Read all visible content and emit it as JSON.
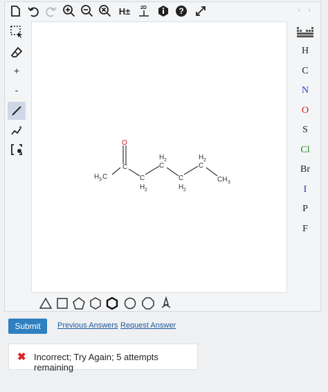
{
  "toolbar": {
    "icons": [
      "new-document",
      "undo",
      "redo",
      "zoom-in",
      "zoom-out",
      "zoom-reset",
      "toggle-hydrogens",
      "clean-2d",
      "info",
      "help",
      "fullscreen"
    ],
    "h_toggle_label": "H±",
    "clean_label": "2D",
    "help_label": "?"
  },
  "left_tools": {
    "plus_label": "+",
    "minus_label": "-"
  },
  "atoms": {
    "items": [
      {
        "label": "H",
        "color": "#222222"
      },
      {
        "label": "C",
        "color": "#222222"
      },
      {
        "label": "N",
        "color": "#1f3fd0"
      },
      {
        "label": "O",
        "color": "#d02020"
      },
      {
        "label": "S",
        "color": "#222222"
      },
      {
        "label": "Cl",
        "color": "#1e8a1e"
      },
      {
        "label": "Br",
        "color": "#222222"
      },
      {
        "label": "I",
        "color": "#3a2aa0"
      },
      {
        "label": "P",
        "color": "#222222"
      },
      {
        "label": "F",
        "color": "#222222"
      }
    ]
  },
  "molecule": {
    "oxygen": "O",
    "carbonyl_carbon": "C",
    "left_methyl_main": "H",
    "left_methyl_sub": "3",
    "left_methyl_tail": "C",
    "right_methyl": "CH",
    "right_methyl_sub": "3",
    "ch2_main": "H",
    "ch2_sub": "2",
    "ch2_carbon": "C"
  },
  "actions": {
    "submit_label": "Submit",
    "previous_answers_label": "Previous Answers",
    "request_answer_label": "Request Answer"
  },
  "feedback": {
    "message": "Incorrect; Try Again; 5 attempts remaining",
    "icon": "x-icon",
    "color": "#dd2222"
  }
}
